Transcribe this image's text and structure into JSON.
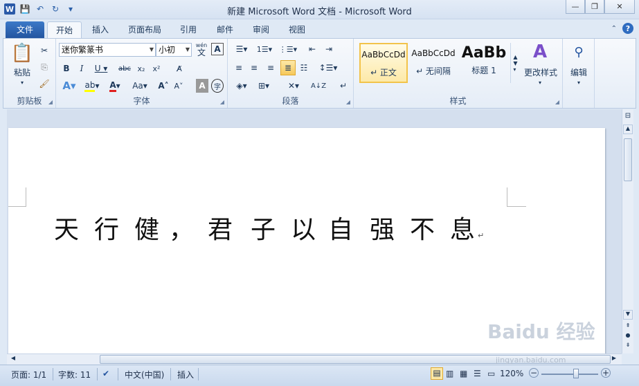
{
  "window": {
    "title": "新建 Microsoft Word 文档  -  Microsoft Word"
  },
  "tabs": [
    "文件",
    "开始",
    "插入",
    "页面布局",
    "引用",
    "邮件",
    "审阅",
    "视图"
  ],
  "clipboard": {
    "paste": "粘贴",
    "group": "剪贴板"
  },
  "font": {
    "name": "迷你繁篆书",
    "size": "小初",
    "group": "字体",
    "pinyin": "wén",
    "pinyin_char": "文",
    "border_char": "A"
  },
  "paragraph": {
    "group": "段落"
  },
  "styles": {
    "group": "样式",
    "items": [
      {
        "sample": "AaBbCcDd",
        "name": "↵ 正文"
      },
      {
        "sample": "AaBbCcDd",
        "name": "↵ 无间隔"
      },
      {
        "sample": "AaBb",
        "name": "标题 1"
      }
    ],
    "change_styles": "更改样式"
  },
  "editing": {
    "label": "编辑"
  },
  "document": {
    "text_chars": [
      "天",
      "行",
      "健",
      "，",
      "君",
      "子",
      "以",
      "自",
      "强",
      "不",
      "息"
    ],
    "para_mark": "↵"
  },
  "status": {
    "page": "页面: 1/1",
    "words": "字数: 11",
    "language": "中文(中国)",
    "mode": "插入",
    "zoom": "120%"
  },
  "watermark": {
    "line1": "Baidu 经验",
    "line2": "jingyan.baidu.com"
  },
  "colors": {
    "accent": "#2455a0",
    "highlight": "#ffff00",
    "font_color": "#e02020"
  }
}
